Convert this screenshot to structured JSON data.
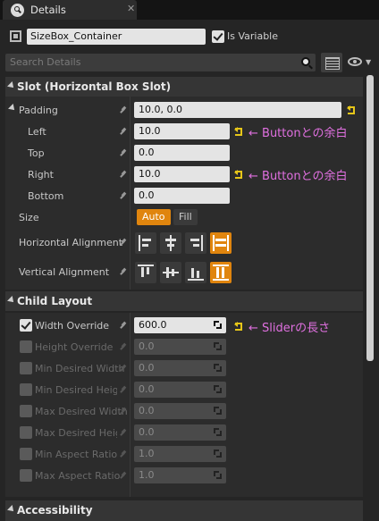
{
  "tab": {
    "title": "Details",
    "close": "✕"
  },
  "header": {
    "widget_name": "SizeBox_Container",
    "is_variable_label": "Is Variable",
    "is_variable_checked": true
  },
  "search": {
    "placeholder": "Search Details"
  },
  "categories": {
    "slot": "Slot (Horizontal Box Slot)",
    "child_layout": "Child Layout",
    "accessibility": "Accessibility"
  },
  "slot": {
    "padding": {
      "label": "Padding",
      "value": "10.0, 0.0"
    },
    "left": {
      "label": "Left",
      "value": "10.0"
    },
    "top": {
      "label": "Top",
      "value": "0.0"
    },
    "right": {
      "label": "Right",
      "value": "10.0"
    },
    "bottom": {
      "label": "Bottom",
      "value": "0.0"
    },
    "size": {
      "label": "Size",
      "auto": "Auto",
      "fill": "Fill",
      "selected": "Auto"
    },
    "horizontal_alignment": {
      "label": "Horizontal Alignment",
      "selected": "fill"
    },
    "vertical_alignment": {
      "label": "Vertical Alignment",
      "selected": "fill"
    }
  },
  "child_layout": {
    "width_override": {
      "label": "Width Override",
      "value": "600.0",
      "checked": true
    },
    "height_override": {
      "label": "Height Override",
      "value": "0.0",
      "checked": false
    },
    "min_desired_width": {
      "label": "Min Desired Width",
      "value": "0.0",
      "checked": false
    },
    "min_desired_height": {
      "label": "Min Desired Height",
      "value": "0.0",
      "checked": false
    },
    "max_desired_width": {
      "label": "Max Desired Width",
      "value": "0.0",
      "checked": false
    },
    "max_desired_height": {
      "label": "Max Desired Height",
      "value": "0.0",
      "checked": false
    },
    "min_aspect_ratio": {
      "label": "Min Aspect Ratio",
      "value": "1.0",
      "checked": false
    },
    "max_aspect_ratio": {
      "label": "Max Aspect Ratio",
      "value": "1.0",
      "checked": false
    }
  },
  "annotations": {
    "left_note": "← Buttonとの余白",
    "right_note": "← Buttonとの余白",
    "width_note": "← Sliderの長さ"
  },
  "colors": {
    "accent": "#e0850e",
    "annotation": "#e070e0",
    "reset_arrow": "#e6c619"
  }
}
